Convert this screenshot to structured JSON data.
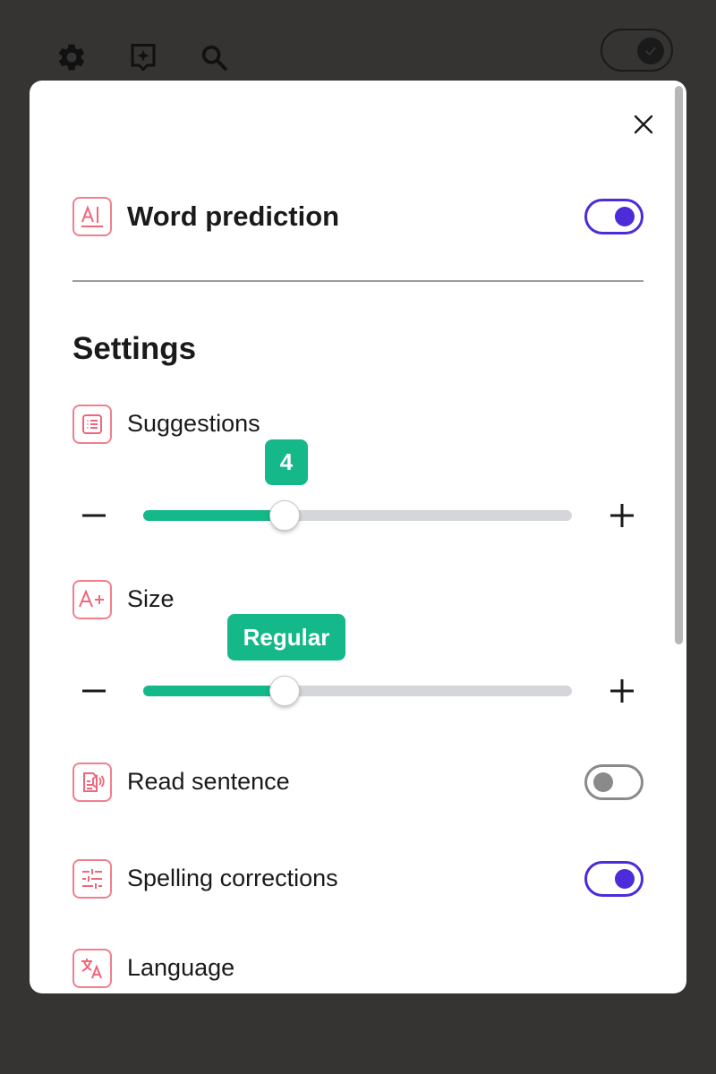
{
  "topbar": {
    "icons": [
      "gear-icon",
      "ai-sparkle-icon",
      "search-icon"
    ],
    "dark_mode_toggle": "on"
  },
  "panel": {
    "close_icon": "close-icon",
    "word_prediction": {
      "label": "Word prediction",
      "icon": "text-cursor-icon",
      "enabled": true
    },
    "settings_title": "Settings",
    "suggestions": {
      "label": "Suggestions",
      "icon": "list-icon",
      "value": "4",
      "level": 0.33
    },
    "size": {
      "label": "Size",
      "icon": "text-size-plus-icon",
      "value": "Regular",
      "level": 0.33
    },
    "read_sentence": {
      "label": "Read sentence",
      "icon": "read-aloud-icon",
      "enabled": false
    },
    "spelling_corrections": {
      "label": "Spelling corrections",
      "icon": "sliders-icon",
      "enabled": true
    },
    "language": {
      "label": "Language",
      "icon": "translate-icon"
    }
  },
  "colors": {
    "accent": "#4d2bd8",
    "slider": "#14b889",
    "icon_border": "#f27f8e",
    "backdrop": "#353432"
  }
}
